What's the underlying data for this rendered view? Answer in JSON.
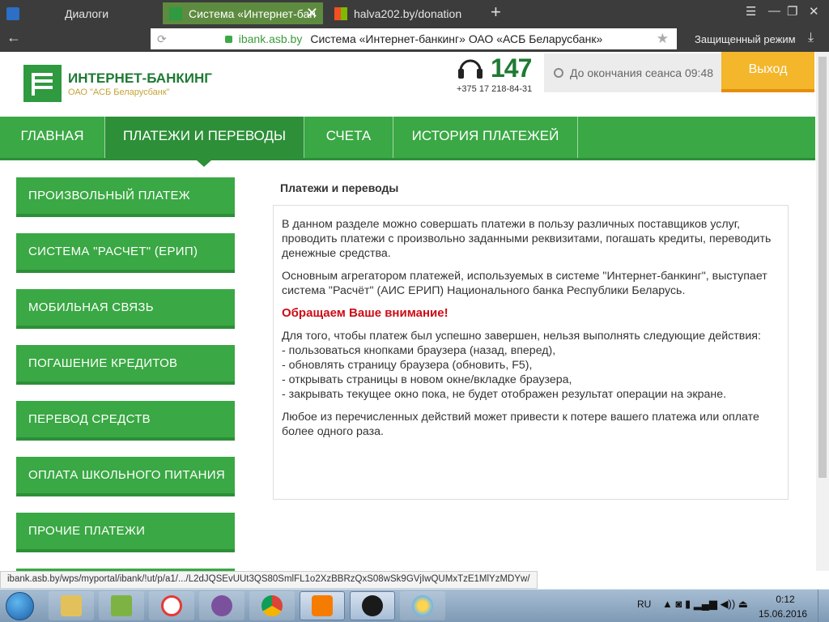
{
  "browser": {
    "tabs": [
      {
        "title": "Диалоги"
      },
      {
        "title": "Система «Интернет-бан"
      },
      {
        "title": "halva202.by/donation"
      }
    ],
    "url_host": "ibank.asb.by",
    "page_title": "Система «Интернет-банкинг» ОАО «АСБ Беларусбанк»",
    "secure_mode": "Защищенный режим"
  },
  "header": {
    "logo_title": "ИНТЕРНЕТ-БАНКИНГ",
    "logo_sub": "ОАО \"АСБ Беларусбанк\"",
    "phone_short": "147",
    "phone_full": "+375 17 218-84-31",
    "session_text": "До окончания сеанса 09:48",
    "logout_label": "Выход"
  },
  "nav": {
    "items": [
      {
        "label": "ГЛАВНАЯ"
      },
      {
        "label": "ПЛАТЕЖИ И ПЕРЕВОДЫ"
      },
      {
        "label": "СЧЕТА"
      },
      {
        "label": "ИСТОРИЯ ПЛАТЕЖЕЙ"
      }
    ]
  },
  "sidebar": {
    "items": [
      {
        "label": "ПРОИЗВОЛЬНЫЙ ПЛАТЕЖ"
      },
      {
        "label": "СИСТЕМА \"РАСЧЕТ\" (ЕРИП)"
      },
      {
        "label": "МОБИЛЬНАЯ СВЯЗЬ"
      },
      {
        "label": "ПОГАШЕНИЕ КРЕДИТОВ"
      },
      {
        "label": "ПЕРЕВОД СРЕДСТВ"
      },
      {
        "label": "ОПЛАТА ШКОЛЬНОГО ПИТАНИЯ"
      },
      {
        "label": "ПРОЧИЕ ПЛАТЕЖИ"
      }
    ]
  },
  "content": {
    "title": "Платежи и переводы",
    "para1": "В данном разделе можно совершать платежи в пользу различных поставщиков услуг, проводить платежи с произвольно заданными реквизитами, погашать кредиты, переводить денежные средства.",
    "para2": "Основным агрегатором платежей, используемых в системе \"Интернет-банкинг\", выступает система \"Расчёт\" (АИС ЕРИП) Национального банка Республики Беларусь.",
    "attention": "Обращаем Ваше внимание!",
    "rules_intro": "Для того, чтобы платеж был успешно завершен, нельзя выполнять следующие действия:",
    "rules": [
      "- пользоваться кнопками браузера (назад, вперед),",
      "- обновлять страницу браузера (обновить, F5),",
      "- открывать страницы в новом окне/вкладке браузера,",
      "- закрывать текущее окно пока, не будет отображен результат операции на экране."
    ],
    "para_last": "Любое из перечисленных действий может привести к потере вашего платежа или оплате более одного раза."
  },
  "status_url": "ibank.asb.by/wps/myportal/ibank/!ut/p/a1/.../L2dJQSEvUUt3QS80SmlFL1o2XzBBRzQxS08wSk9GVjIwQUMxTzE1MlYzMDYw/",
  "taskbar": {
    "lang": "RU",
    "time": "0:12",
    "date": "15.06.2016"
  },
  "colors": {
    "brand_green": "#3aa844",
    "brand_green_dark": "#2d8f38",
    "logout_orange": "#f4b62a",
    "attention_red": "#cc0b16"
  }
}
